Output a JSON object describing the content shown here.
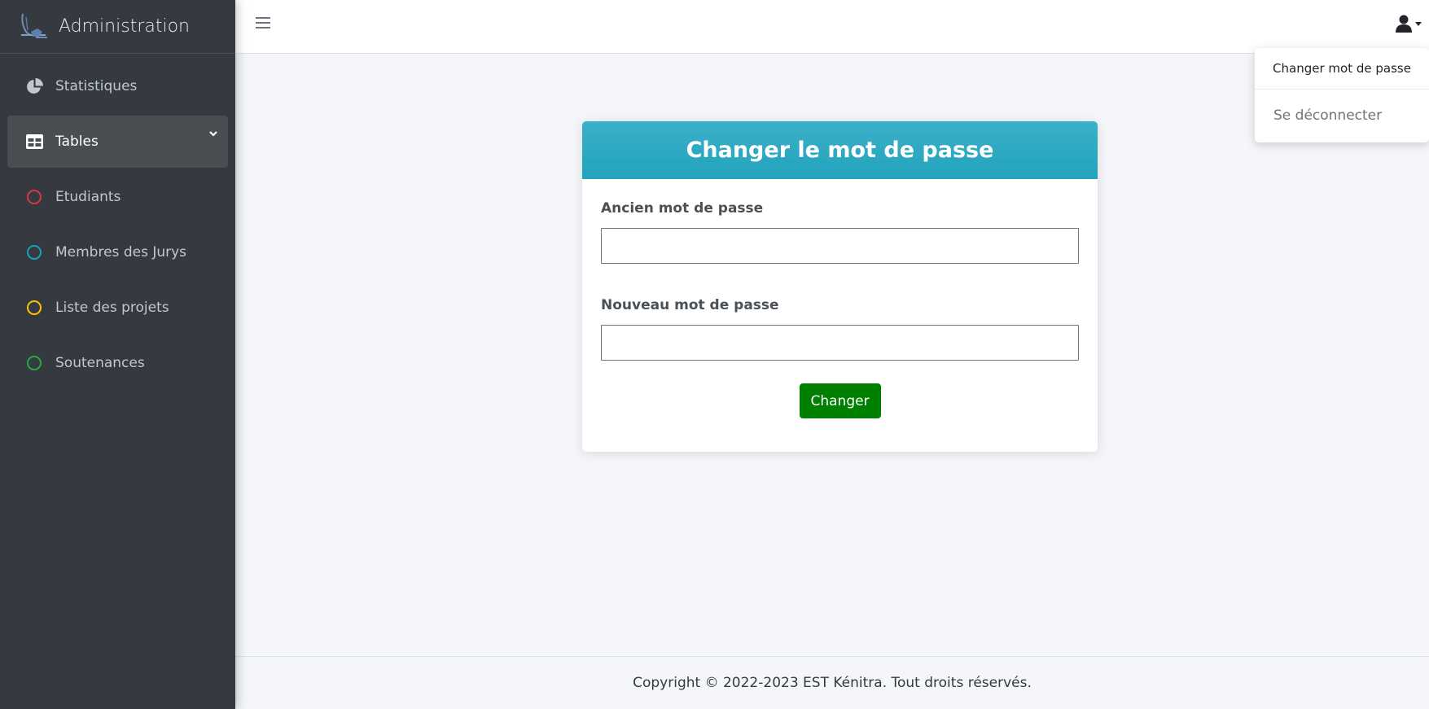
{
  "brand": {
    "title": "Administration"
  },
  "sidebar": {
    "items": [
      {
        "label": "Statistiques",
        "icon": "chart-pie-icon"
      },
      {
        "label": "Tables",
        "icon": "table-icon",
        "active": true
      },
      {
        "label": "Etudiants",
        "icon": "circle-icon",
        "color": "#dc3545"
      },
      {
        "label": "Membres des Jurys",
        "icon": "circle-icon",
        "color": "#17a2b8"
      },
      {
        "label": "Liste des projets",
        "icon": "circle-icon",
        "color": "#ffc107"
      },
      {
        "label": "Soutenances",
        "icon": "circle-icon",
        "color": "#28a745"
      }
    ]
  },
  "user_menu": {
    "items": [
      {
        "label": "Changer mot de passe"
      },
      {
        "label": "Se déconnecter"
      }
    ]
  },
  "form": {
    "title": "Changer le mot de passe",
    "old_password_label": "Ancien mot de passe",
    "old_password_value": "",
    "new_password_label": "Nouveau mot de passe",
    "new_password_value": "",
    "submit_label": "Changer"
  },
  "footer": {
    "text": "Copyright © 2022-2023 EST Kénitra. Tout droits réservés."
  },
  "colors": {
    "sidebar_bg": "#343a40",
    "card_header": "#22a3bc",
    "submit_button": "#008000"
  }
}
